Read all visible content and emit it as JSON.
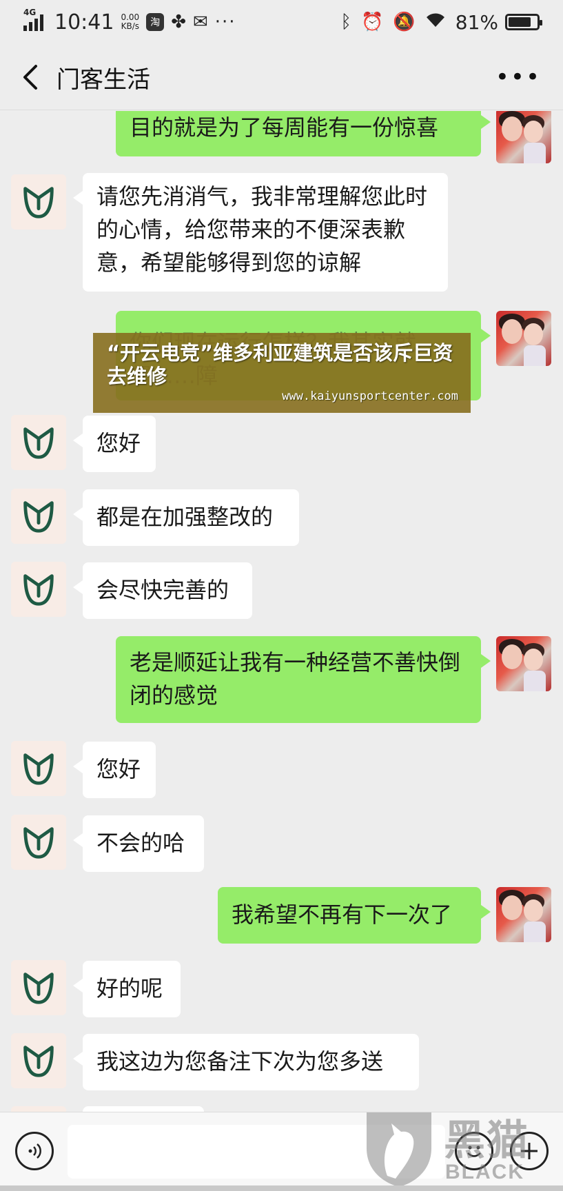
{
  "status_bar": {
    "network": "4G",
    "time": "10:41",
    "speed_value": "0.00",
    "speed_unit": "KB/s",
    "app_icon": "淘",
    "battery": "81%",
    "battery_level": 0.81
  },
  "nav": {
    "title": "门客生活"
  },
  "messages": [
    {
      "side": "out",
      "text": "目的就是为了每周能有一份惊喜"
    },
    {
      "side": "in",
      "text": "请您先消消气，我非常理解您此时的心情，给您带来的不便深表歉意，希望能够得到您的谅解"
    },
    {
      "side": "out",
      "text": "你们现在运行怎样？我其实就想……障"
    },
    {
      "side": "in",
      "text": "您好"
    },
    {
      "side": "in",
      "text": "都是在加强整改的"
    },
    {
      "side": "in",
      "text": "会尽快完善的"
    },
    {
      "side": "out",
      "text": "老是顺延让我有一种经营不善快倒闭的感觉"
    },
    {
      "side": "in",
      "text": "您好"
    },
    {
      "side": "in",
      "text": "不会的哈"
    },
    {
      "side": "out",
      "text": "我希望不再有下一次了"
    },
    {
      "side": "in",
      "text": "好的呢"
    },
    {
      "side": "in",
      "text": "我这边为您备注下次为您多送"
    }
  ],
  "overlay": {
    "title": "“开云电竞”维多利亚建筑是否该斥巨资去维修",
    "url": "www.kaiyunsportcenter.com"
  },
  "input_bar": {
    "placeholder": ""
  },
  "watermark": {
    "cn": "黑猫",
    "en": "BLACK CAT"
  },
  "colors": {
    "outgoing_bubble": "#95ec69",
    "incoming_bubble": "#ffffff",
    "background": "#ededed",
    "brand_green": "#1e5a44"
  }
}
